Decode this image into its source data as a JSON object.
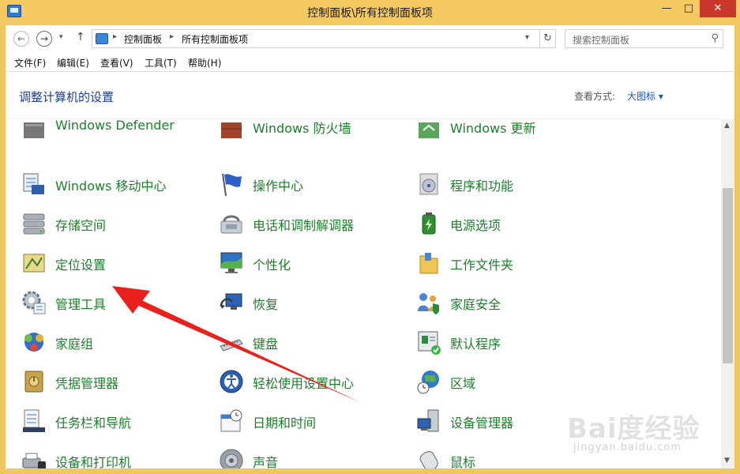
{
  "window": {
    "title": "控制面板\\所有控制面板项",
    "min": "—",
    "max": "□",
    "close": "✕"
  },
  "nav": {
    "back": "←",
    "forward": "→",
    "recent": "▾",
    "up": "↑",
    "breadcrumb": [
      "控制面板",
      "所有控制面板项"
    ],
    "arrow": "▸",
    "dropdown": "▾",
    "refresh": "↻"
  },
  "search": {
    "placeholder": "搜索控制面板",
    "icon": "⚲"
  },
  "menu": [
    "文件(F)",
    "编辑(E)",
    "查看(V)",
    "工具(T)",
    "帮助(H)"
  ],
  "header": {
    "title": "调整计算机的设置",
    "view_label": "查看方式:",
    "view_value": "大图标 ▾"
  },
  "items": {
    "row0": [
      "Windows Defender",
      "Windows 防火墙",
      "Windows 更新"
    ],
    "row1": [
      "Windows 移动中心",
      "操作中心",
      "程序和功能"
    ],
    "row2": [
      "存储空间",
      "电话和调制解调器",
      "电源选项"
    ],
    "row3": [
      "定位设置",
      "个性化",
      "工作文件夹"
    ],
    "row4": [
      "管理工具",
      "恢复",
      "家庭安全"
    ],
    "row5": [
      "家庭组",
      "键盘",
      "默认程序"
    ],
    "row6": [
      "凭据管理器",
      "轻松使用设置中心",
      "区域"
    ],
    "row7": [
      "任务栏和导航",
      "日期和时间",
      "设备管理器"
    ],
    "row8": [
      "设备和打印机",
      "声音",
      "鼠标"
    ]
  },
  "scrollbar": {
    "up": "▲",
    "down": "▼"
  },
  "watermark": {
    "main": "Bai度经验",
    "sub": "jingyan.baidu.com"
  },
  "colors": {
    "frame": "#f6ca62",
    "item_text": "#1d7e2c",
    "title_text": "#1e3e8c",
    "link": "#1f56b3",
    "annotation_arrow": "#e8211c"
  }
}
